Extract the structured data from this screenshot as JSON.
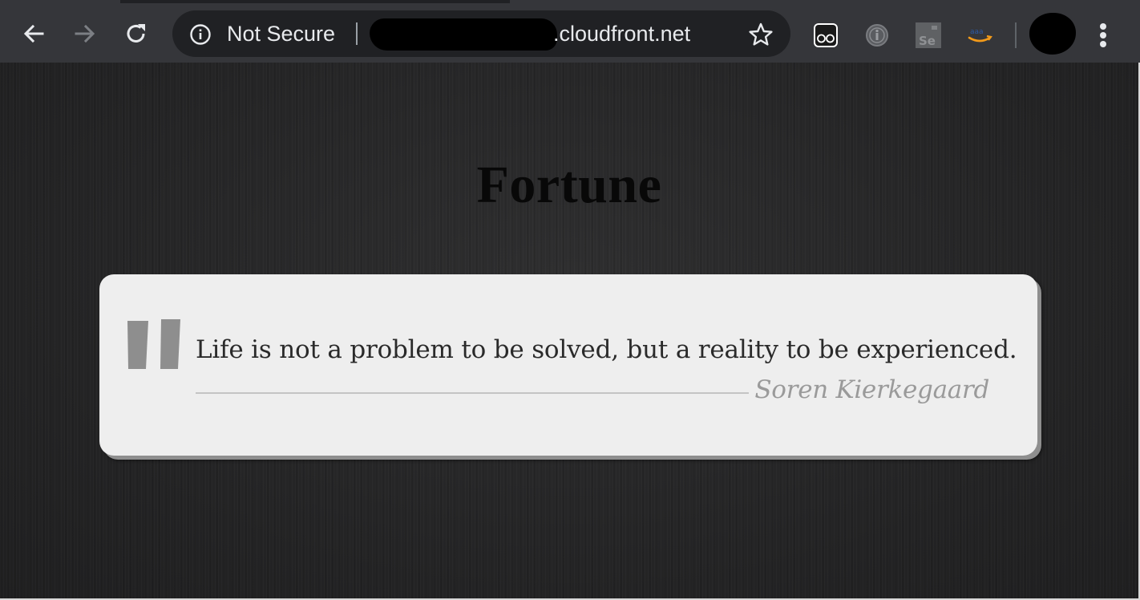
{
  "browser": {
    "security_label": "Not Secure",
    "url_domain": ".cloudfront.net",
    "extensions": [
      "tab-suspender-icon",
      "info-extension-icon",
      "selenium-icon",
      "amazon-icon"
    ]
  },
  "page": {
    "title": "Fortune",
    "quote": {
      "text": "Life is not a problem to be solved, but a reality to be experienced.",
      "author": "Soren Kierkegaard"
    }
  },
  "colors": {
    "toolbar": "#35363a",
    "omnibox": "#202124",
    "page_background": "#252526",
    "card": "#eeeeee",
    "quote_mark": "#8e8e8e",
    "author": "#9a9a9a"
  }
}
